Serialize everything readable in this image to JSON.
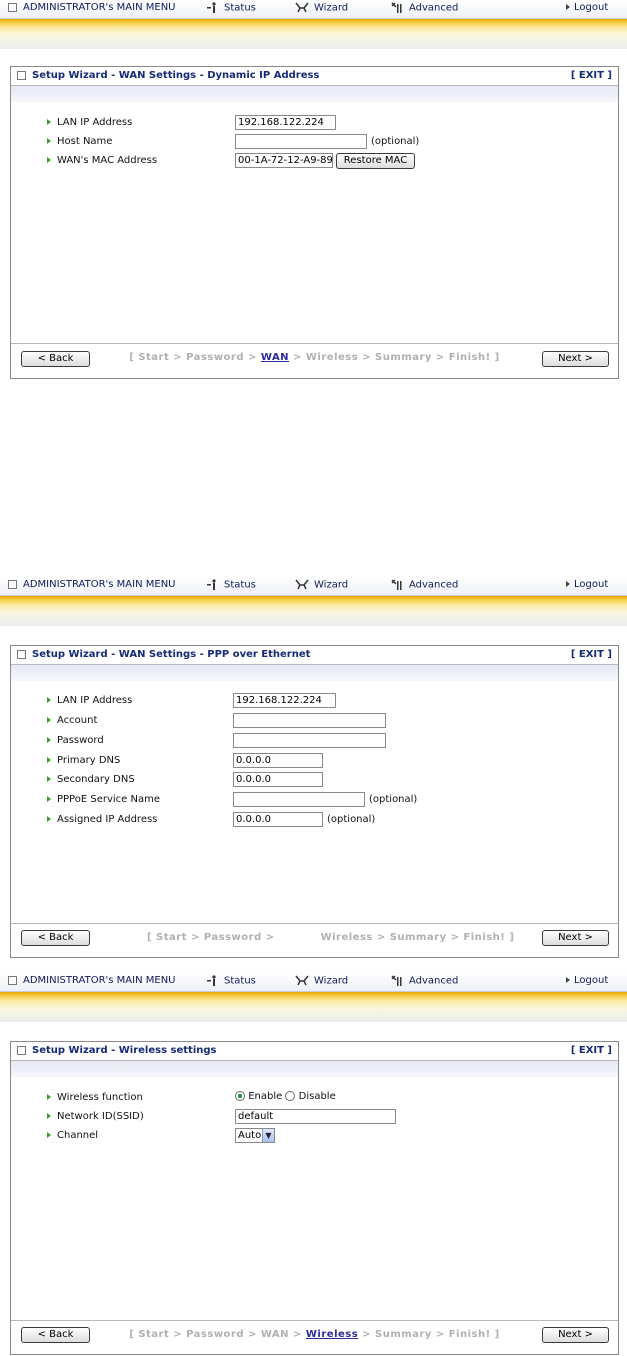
{
  "menu": {
    "admin": "ADMINISTRATOR's MAIN MENU",
    "status": "Status",
    "wizard": "Wizard",
    "advanced": "Advanced",
    "logout": "Logout"
  },
  "screens": [
    {
      "title": "Setup Wizard - WAN Settings - Dynamic IP Address",
      "exit": "[ EXIT ]",
      "fields": {
        "lan_ip": {
          "label": "LAN IP Address",
          "value": "192.168.122.224"
        },
        "host_name": {
          "label": "Host Name",
          "value": "",
          "note": "(optional)"
        },
        "mac": {
          "label": "WAN's MAC Address",
          "value": "00-1A-72-12-A9-89",
          "button": "Restore MAC"
        }
      },
      "footer": {
        "back": "< Back",
        "next": "Next >",
        "steps_pre": "[ Start > Password > ",
        "steps_cur": "WAN",
        "steps_post": " > Wireless > Summary > Finish! ]"
      }
    },
    {
      "title": "Setup Wizard - WAN Settings - PPP over Ethernet",
      "exit": "[ EXIT ]",
      "fields": {
        "lan_ip": {
          "label": "LAN IP Address",
          "value": "192.168.122.224"
        },
        "account": {
          "label": "Account",
          "value": ""
        },
        "password": {
          "label": "Password",
          "value": ""
        },
        "dns1": {
          "label": "Primary DNS",
          "value": "0.0.0.0"
        },
        "dns2": {
          "label": "Secondary DNS",
          "value": "0.0.0.0"
        },
        "service": {
          "label": "PPPoE Service Name",
          "value": "",
          "note": "(optional)"
        },
        "assigned_ip": {
          "label": "Assigned IP Address",
          "value": "0.0.0.0",
          "note": "(optional)"
        }
      },
      "footer": {
        "back": "< Back",
        "next": "Next >",
        "steps_pre": "[ Start > Password > ",
        "steps_post": "Wireless > Summary > Finish! ]"
      }
    },
    {
      "title": "Setup Wizard - Wireless settings",
      "exit": "[ EXIT ]",
      "fields": {
        "wireless": {
          "label": "Wireless function",
          "enable": "Enable",
          "disable": "Disable",
          "selected": "Enable"
        },
        "ssid": {
          "label": "Network ID(SSID)",
          "value": "default"
        },
        "channel": {
          "label": "Channel",
          "value": "Auto"
        }
      },
      "footer": {
        "back": "< Back",
        "next": "Next >",
        "steps_pre": "[ Start > Password > WAN > ",
        "steps_cur": "Wireless",
        "steps_post": " > Summary > Finish! ]"
      }
    }
  ],
  "colors": {
    "menu_text": "#0f1a5c",
    "title_text": "#162a78",
    "bullet": "#3c9c2c",
    "step_current": "#2b2b9e",
    "step_inactive": "#b0b0b0"
  },
  "icons": [
    "square-bullet-icon",
    "status-person-icon",
    "wizard-icon",
    "advanced-tools-icon",
    "arrow-right-icon",
    "green-arrow-bullet-icon"
  ]
}
